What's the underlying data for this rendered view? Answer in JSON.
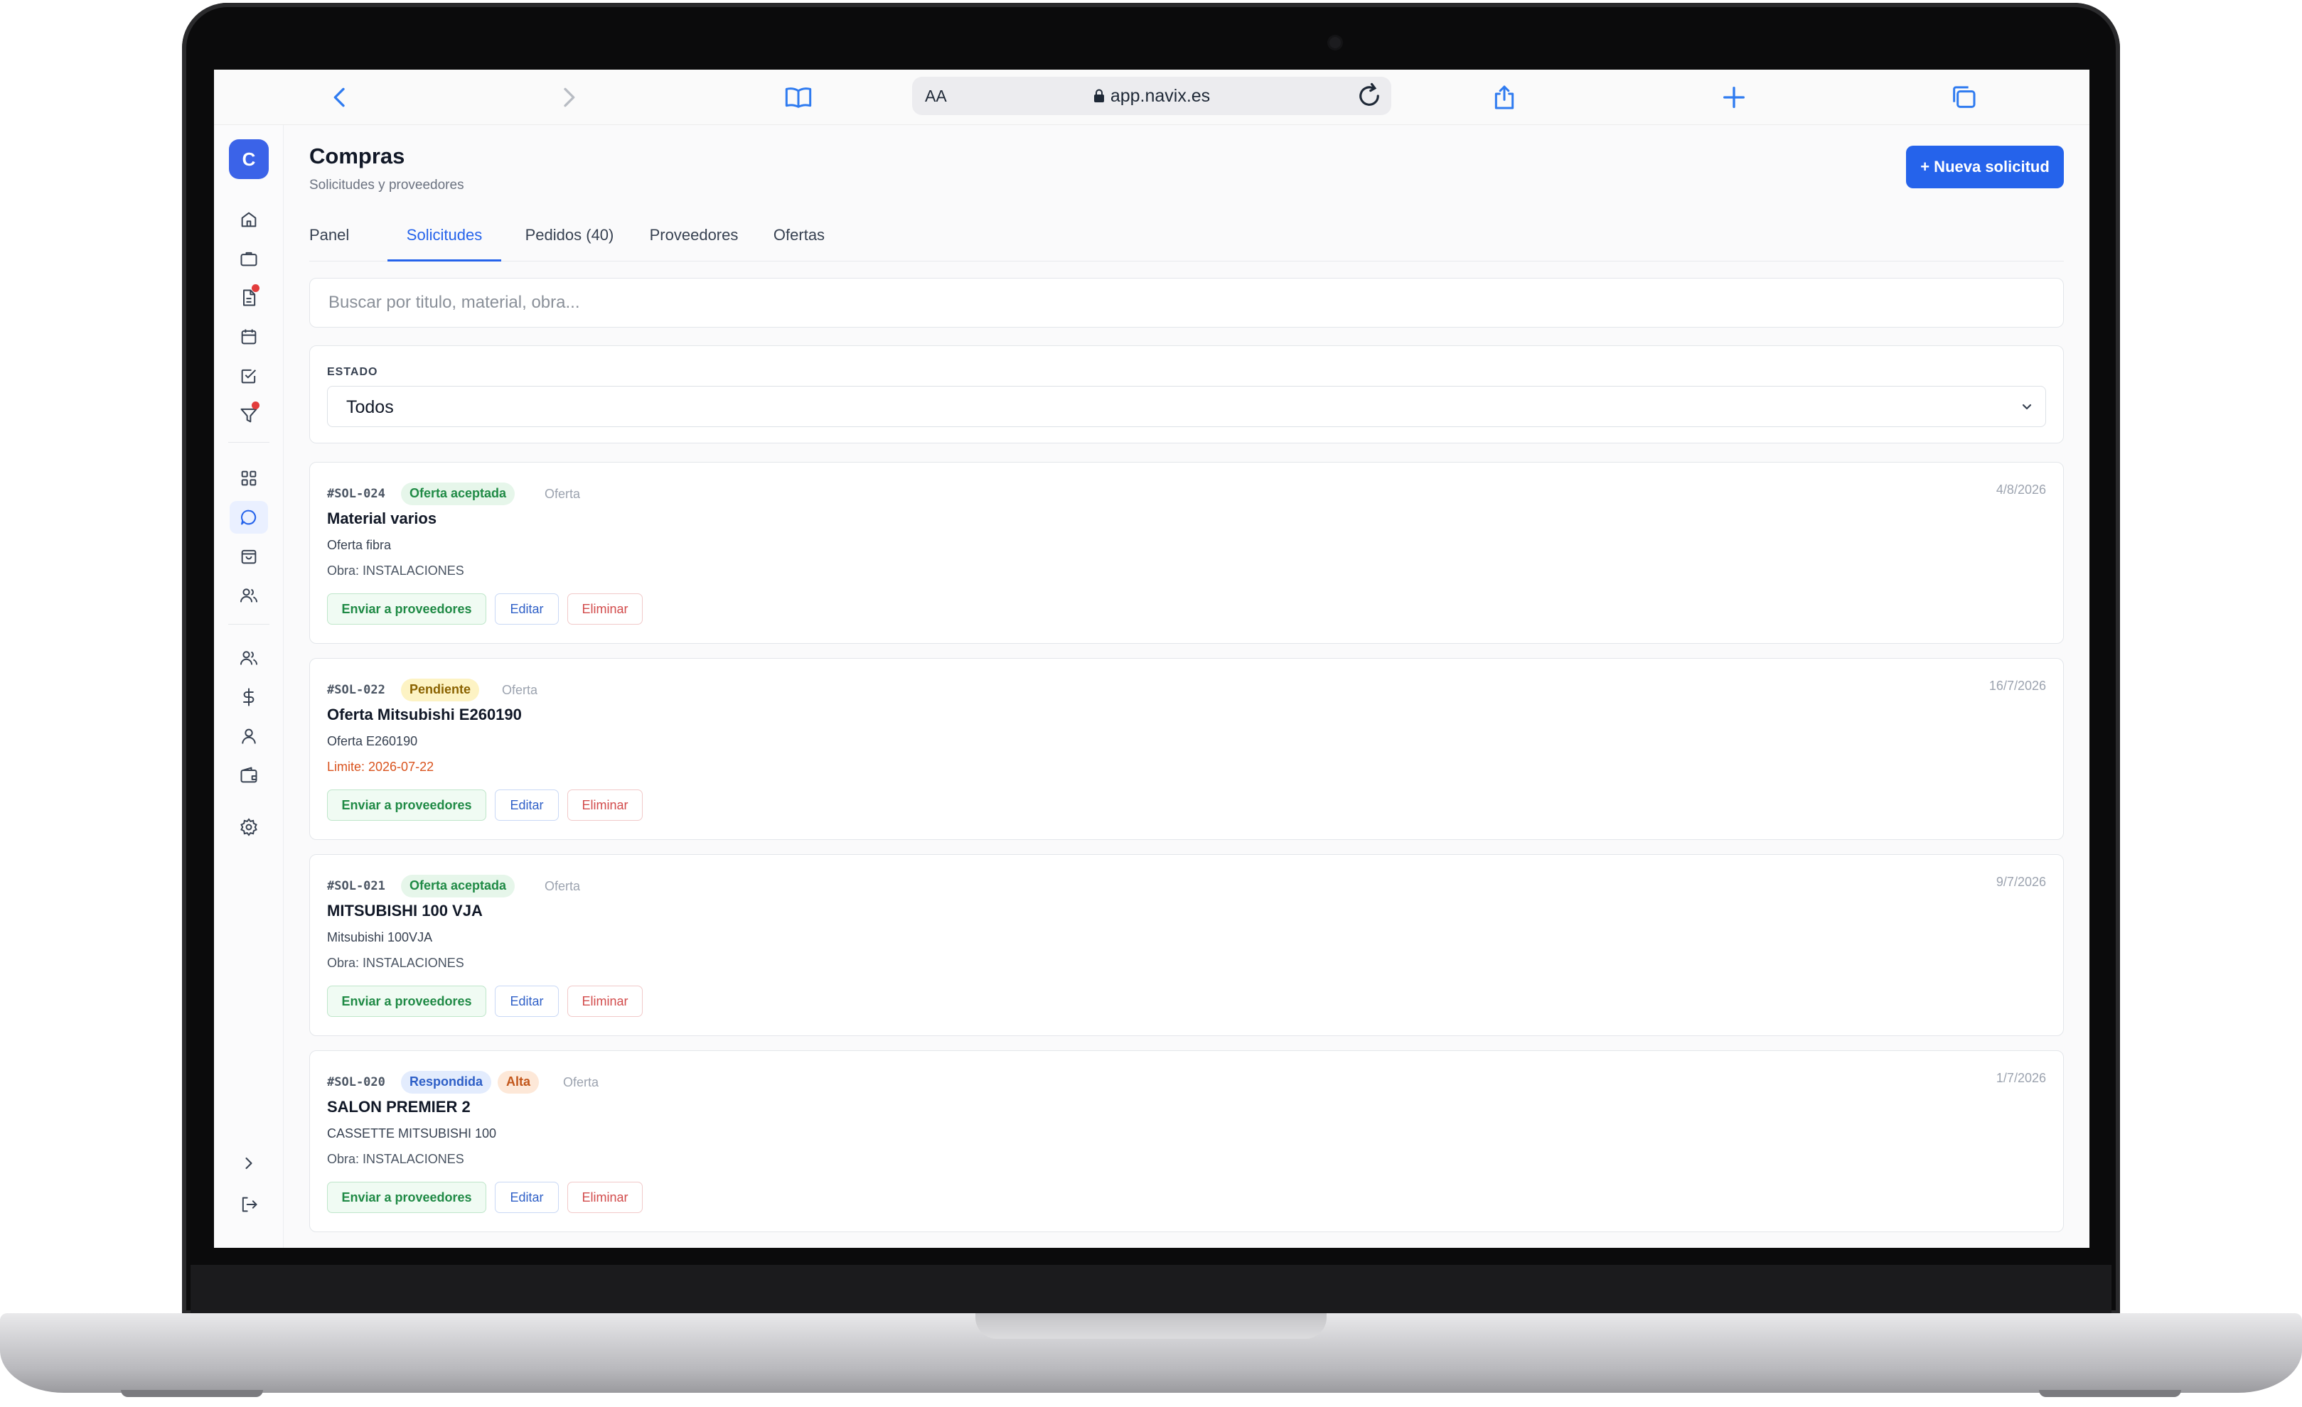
{
  "browser": {
    "text_size_label": "AA",
    "url": "app.navix.es"
  },
  "sidebar": {
    "logo_letter": "C",
    "icons": [
      "home-icon",
      "briefcase-icon",
      "document-icon",
      "calendar-icon",
      "checklist-icon",
      "filter-icon",
      "grid-icon",
      "chat-icon",
      "shopping-bag-icon",
      "users-icon",
      "team-icon",
      "dollar-icon",
      "user-icon",
      "wallet-icon",
      "settings-icon",
      "expand-icon",
      "logout-icon"
    ]
  },
  "header": {
    "title": "Compras",
    "subtitle": "Solicitudes y proveedores",
    "new_button": "+ Nueva solicitud"
  },
  "tabs": [
    {
      "label": "Panel",
      "active": false
    },
    {
      "label": "Solicitudes",
      "active": true
    },
    {
      "label": "Pedidos (40)",
      "active": false
    },
    {
      "label": "Proveedores",
      "active": false
    },
    {
      "label": "Ofertas",
      "active": false
    }
  ],
  "search": {
    "placeholder": "Buscar por titulo, material, obra..."
  },
  "filter": {
    "label": "ESTADO",
    "value": "Todos"
  },
  "requests": [
    {
      "code": "#SOL-024",
      "badges": [
        {
          "text": "Oferta aceptada",
          "bg": "#e6f6ea",
          "fg": "#1f8a45"
        }
      ],
      "kind": "Oferta",
      "date": "4/8/2026",
      "title": "Material varios",
      "description": "Oferta fibra",
      "meta": "Obra: INSTALACIONES",
      "meta_color": "#4b5563"
    },
    {
      "code": "#SOL-022",
      "badges": [
        {
          "text": "Pendiente",
          "bg": "#fdf3c4",
          "fg": "#8a6200"
        }
      ],
      "kind": "Oferta",
      "date": "16/7/2026",
      "title": "Oferta Mitsubishi E260190",
      "description": "Oferta E260190",
      "meta": "Limite: 2026-07-22",
      "meta_color": "#d9531e"
    },
    {
      "code": "#SOL-021",
      "badges": [
        {
          "text": "Oferta aceptada",
          "bg": "#e6f6ea",
          "fg": "#1f8a45"
        }
      ],
      "kind": "Oferta",
      "date": "9/7/2026",
      "title": "MITSUBISHI 100 VJA",
      "description": "Mitsubishi 100VJA",
      "meta": "Obra: INSTALACIONES",
      "meta_color": "#4b5563"
    },
    {
      "code": "#SOL-020",
      "badges": [
        {
          "text": "Respondida",
          "bg": "#e3ecfd",
          "fg": "#2e5fc7"
        },
        {
          "text": "Alta",
          "bg": "#fde8d8",
          "fg": "#c2561a"
        }
      ],
      "kind": "Oferta",
      "date": "1/7/2026",
      "title": "SALON PREMIER 2",
      "description": "CASSETTE MITSUBISHI 100",
      "meta": "Obra: INSTALACIONES",
      "meta_color": "#4b5563"
    }
  ],
  "actions": {
    "send": "Enviar a proveedores",
    "edit": "Editar",
    "delete": "Eliminar"
  },
  "colors": {
    "accent": "#2563eb",
    "logo": "#3b63e8",
    "notification_dot": "#e23c3c"
  }
}
